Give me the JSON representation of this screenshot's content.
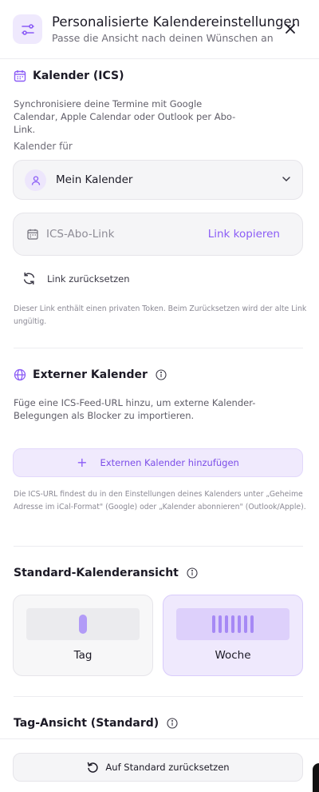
{
  "header": {
    "title": "Personalisierte Kalendereinstellungen",
    "subtitle": "Passe die Ansicht nach deinen Wünschen an",
    "icon": "sliders-icon",
    "close_icon": "close-icon"
  },
  "ics_section": {
    "title": "Kalender (ICS)",
    "description": "Synchronisiere deine Termine mit Google Calendar, Apple Calendar oder Outlook per Abo-Link.",
    "calendar_for_label": "Kalender für",
    "selected_calendar": "Mein Kalender",
    "ics_placeholder": "ICS-Abo-Link",
    "copy_link_label": "Link kopieren",
    "reset_link_label": "Link zurücksetzen",
    "note": "Dieser Link enthält einen privaten Token. Beim Zurücksetzen wird der alte Link ungültig."
  },
  "external_section": {
    "title": "Externer Kalender",
    "description": "Füge eine ICS-Feed-URL hinzu, um externe Kalender-Belegungen als Blocker zu importieren.",
    "add_button_label": "Externen Kalender hinzufügen",
    "note": "Die ICS-URL findest du in den Einstellungen deines Kalenders unter „Geheime Adresse im iCal-Format\" (Google) oder „Kalender abonnieren\" (Outlook/Apple)."
  },
  "default_view_section": {
    "title": "Standard-Kalenderansicht",
    "options": [
      {
        "label": "Tag",
        "selected": false
      },
      {
        "label": "Woche",
        "selected": true
      }
    ]
  },
  "day_view_section": {
    "title": "Tag-Ansicht (Standard)"
  },
  "footer": {
    "reset_button_label": "Auf Standard zurücksetzen"
  },
  "colors": {
    "accent": "#8b5cf6",
    "accent_bg": "#efe9fd"
  }
}
